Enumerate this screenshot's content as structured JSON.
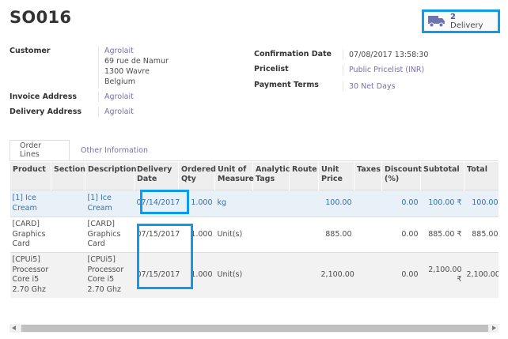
{
  "order": {
    "name": "SO016"
  },
  "smart_button": {
    "count": "2",
    "label": "Delivery"
  },
  "fields": {
    "customer": {
      "label": "Customer",
      "name": "Agrolait",
      "address": [
        "69 rue de Namur",
        "1300 Wavre",
        "Belgium"
      ]
    },
    "invoice_address": {
      "label": "Invoice Address",
      "value": "Agrolait"
    },
    "delivery_address": {
      "label": "Delivery Address",
      "value": "Agrolait"
    },
    "confirmation_date": {
      "label": "Confirmation Date",
      "value": "07/08/2017 13:58:30"
    },
    "pricelist": {
      "label": "Pricelist",
      "value": "Public Pricelist (INR)"
    },
    "payment_terms": {
      "label": "Payment Terms",
      "value": "30 Net Days"
    }
  },
  "tabs": [
    {
      "label": "Order Lines"
    },
    {
      "label": "Other Information"
    }
  ],
  "columns": [
    "Product",
    "Section",
    "Description",
    "Delivery Date",
    "Ordered Qty",
    "Unit of Measure",
    "Analytic Tags",
    "Route",
    "Unit Price",
    "Taxes",
    "Discount (%)",
    "Subtotal",
    "Total"
  ],
  "rows": [
    {
      "product": "[1] Ice Cream",
      "section": "",
      "description": "[1] Ice Cream",
      "delivery_date": "07/14/2017",
      "qty": "1.000",
      "uom": "kg",
      "tags": "",
      "route": "",
      "unit_price": "100.00",
      "taxes": "",
      "discount": "0.00",
      "subtotal": "100.00 ₹",
      "total": "100.00"
    },
    {
      "product": "[CARD] Graphics Card",
      "section": "",
      "description": "[CARD] Graphics Card",
      "delivery_date": "07/15/2017",
      "qty": "1.000",
      "uom": "Unit(s)",
      "tags": "",
      "route": "",
      "unit_price": "885.00",
      "taxes": "",
      "discount": "0.00",
      "subtotal": "885.00 ₹",
      "total": "885.00"
    },
    {
      "product": "[CPUi5] Processor Core i5 2.70 Ghz",
      "section": "",
      "description": "[CPUi5] Processor Core i5 2.70 Ghz",
      "delivery_date": "07/15/2017",
      "qty": "1.000",
      "uom": "Unit(s)",
      "tags": "",
      "route": "",
      "unit_price": "2,100.00",
      "taxes": "",
      "discount": "0.00",
      "subtotal": "2,100.00 ₹",
      "total": "2,100.00"
    }
  ],
  "icons": {
    "truck": "truck-icon"
  },
  "colors": {
    "highlight": "#0d9bea",
    "link": "#7c6ea9",
    "selected_row": "#e9f1f8"
  }
}
